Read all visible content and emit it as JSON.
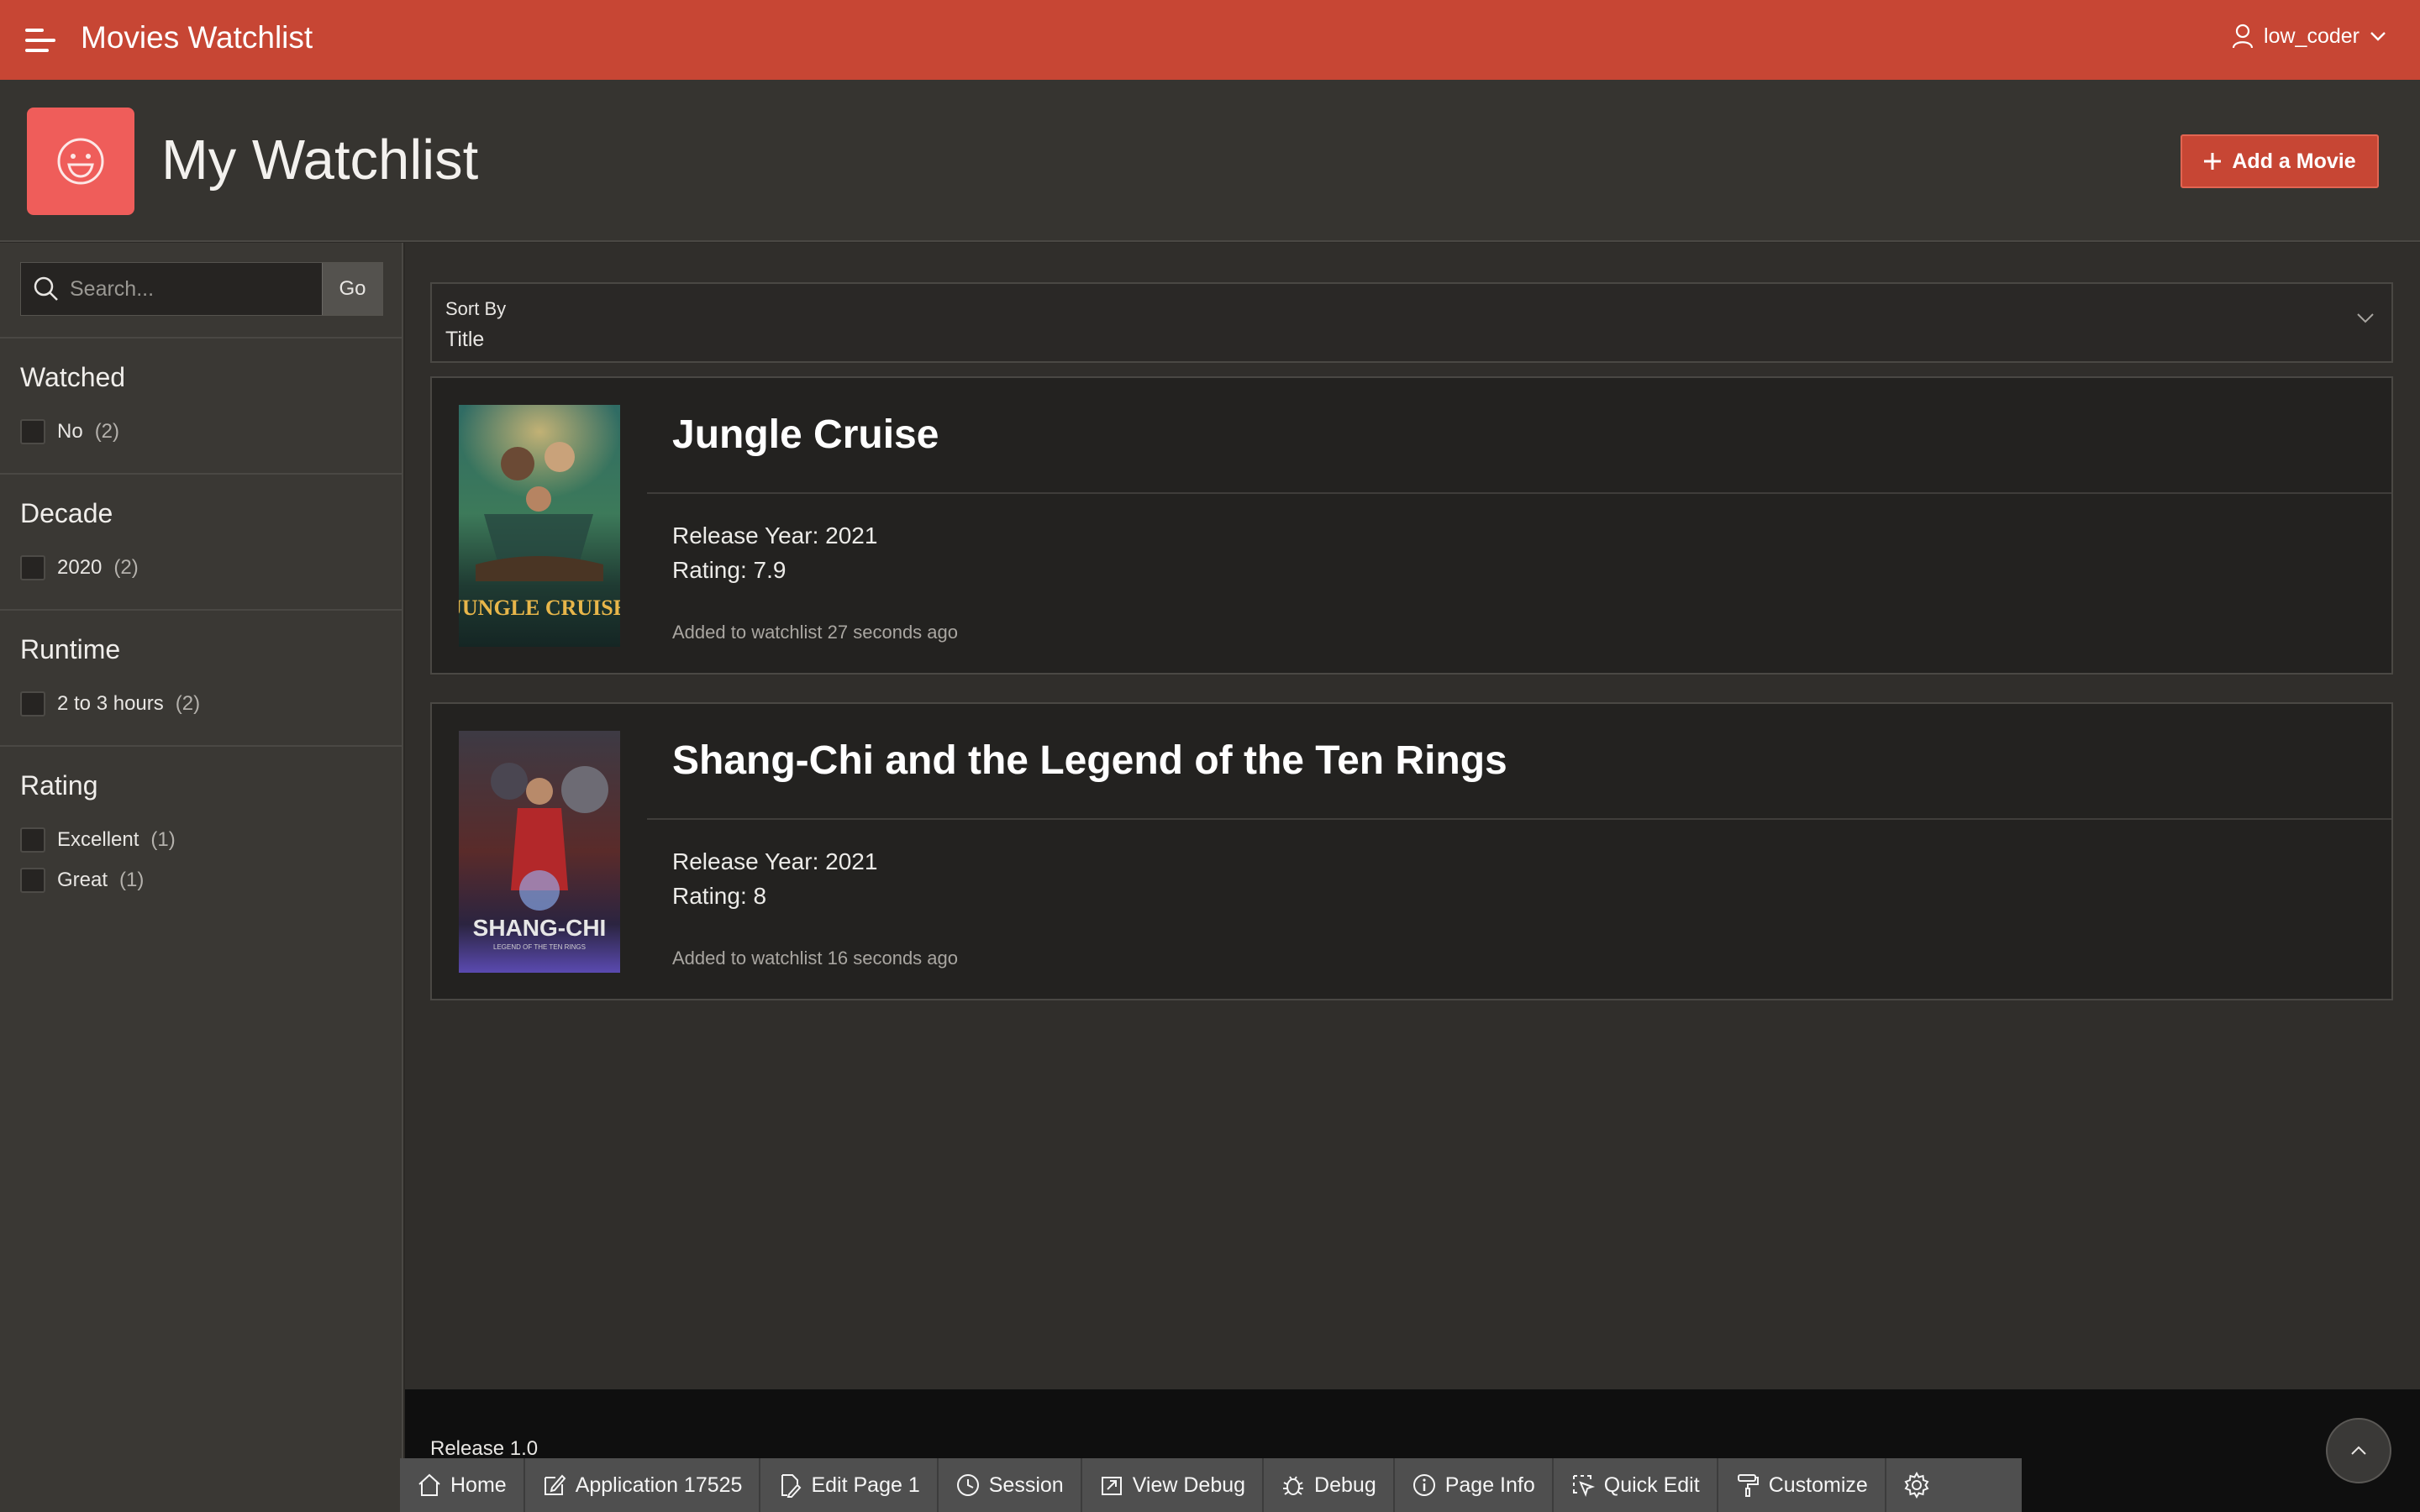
{
  "header": {
    "app_title": "Movies Watchlist",
    "user_name": "low_coder",
    "brand_color": "#c74634"
  },
  "hero": {
    "title": "My Watchlist",
    "add_button_label": "Add a Movie",
    "icon": "smile-icon"
  },
  "search": {
    "placeholder": "Search...",
    "go_label": "Go"
  },
  "facets": [
    {
      "title": "Watched",
      "options": [
        {
          "label": "No",
          "count": "(2)"
        }
      ]
    },
    {
      "title": "Decade",
      "options": [
        {
          "label": "2020",
          "count": "(2)"
        }
      ]
    },
    {
      "title": "Runtime",
      "options": [
        {
          "label": "2 to 3 hours",
          "count": "(2)"
        }
      ]
    },
    {
      "title": "Rating",
      "options": [
        {
          "label": "Excellent",
          "count": "(1)"
        },
        {
          "label": "Great",
          "count": "(1)"
        }
      ]
    }
  ],
  "sort": {
    "label": "Sort By",
    "value": "Title"
  },
  "movies": [
    {
      "title": "Jungle Cruise",
      "release": "Release Year: 2021",
      "rating": "Rating: 7.9",
      "added": "Added to watchlist 27 seconds ago",
      "poster_text": "JUNGLE CRUISE"
    },
    {
      "title": "Shang-Chi and the Legend of the Ten Rings",
      "release": "Release Year: 2021",
      "rating": "Rating: 8",
      "added": "Added to watchlist 16 seconds ago",
      "poster_text": "SHANG-CHI",
      "poster_subtext": "LEGEND OF THE TEN RINGS"
    }
  ],
  "footer": {
    "release": "Release 1.0"
  },
  "dev_toolbar": {
    "home": "Home",
    "application": "Application 17525",
    "edit_page": "Edit Page 1",
    "session": "Session",
    "view_debug": "View Debug",
    "debug": "Debug",
    "page_info": "Page Info",
    "quick_edit": "Quick Edit",
    "customize": "Customize"
  }
}
